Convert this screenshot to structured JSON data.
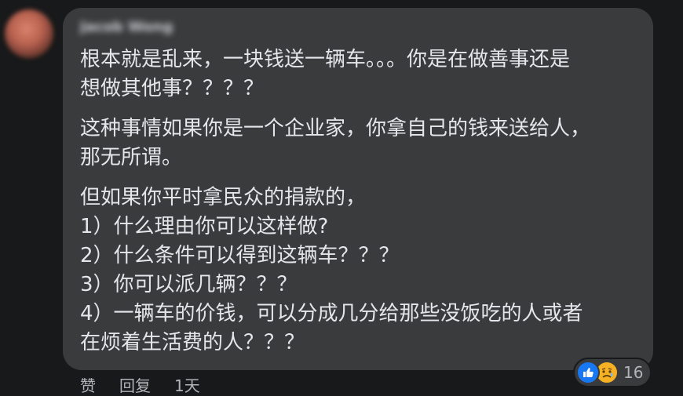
{
  "comment": {
    "author": "Jacob Wong",
    "lines": {
      "p1_l1": "根本就是乱来，一块钱送一辆车。。。你是在做善事还是",
      "p1_l2": "想做其他事？？？？",
      "p2_l1": "这种事情如果你是一个企业家，你拿自己的钱来送给人，",
      "p2_l2": "那无所谓。",
      "p3_l1": "但如果你平时拿民众的捐款的，",
      "p3_l2": "1）什么理由你可以这样做?",
      "p3_l3": "2）什么条件可以得到这辆车？？？",
      "p3_l4": "3）你可以派几辆？？？",
      "p3_l5": "4）一辆车的价钱，可以分成几分给那些没饭吃的人或者",
      "p3_l6": "在烦着生活费的人？？？"
    }
  },
  "actions": {
    "like_label": "赞",
    "reply_label": "回复",
    "time_label": "1天"
  },
  "reactions": {
    "count": "16",
    "icons": [
      "like-icon",
      "sad-icon"
    ],
    "like_color": "#1877f2",
    "sad_color": "#f7b125"
  }
}
